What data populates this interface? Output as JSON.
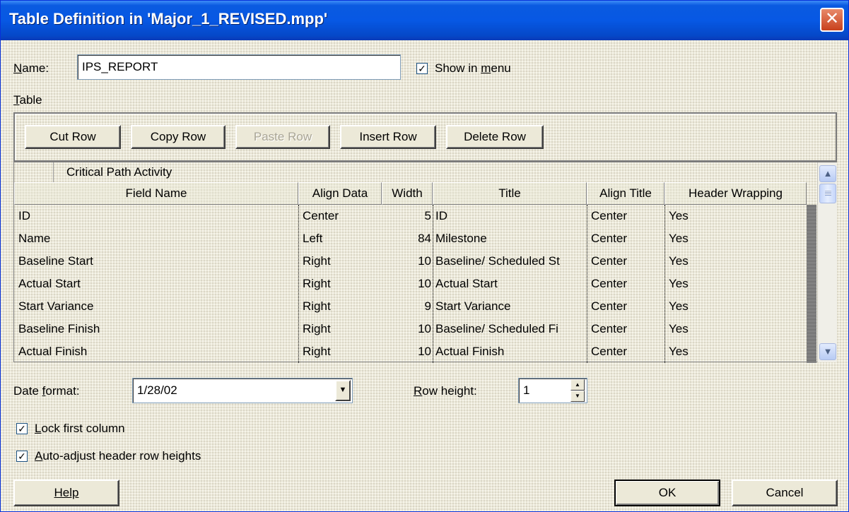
{
  "window": {
    "title": "Table Definition in 'Major_1_REVISED.mpp'"
  },
  "name_field": {
    "label": "Name:",
    "value": "IPS_REPORT"
  },
  "show_in_menu": {
    "label": "Show in menu",
    "checked": true
  },
  "table_group": {
    "label": "Table"
  },
  "toolbar": {
    "cut_row": "Cut Row",
    "copy_row": "Copy Row",
    "paste_row": "Paste Row",
    "insert_row": "Insert Row",
    "delete_row": "Delete Row"
  },
  "grid": {
    "edit_value": "Critical Path Activity",
    "columns": [
      "Field Name",
      "Align Data",
      "Width",
      "Title",
      "Align Title",
      "Header Wrapping"
    ],
    "rows": [
      [
        "ID",
        "Center",
        "5",
        "ID",
        "Center",
        "Yes"
      ],
      [
        "Name",
        "Left",
        "84",
        "Milestone",
        "Center",
        "Yes"
      ],
      [
        "Baseline Start",
        "Right",
        "10",
        "Baseline/ Scheduled St",
        "Center",
        "Yes"
      ],
      [
        "Actual Start",
        "Right",
        "10",
        "Actual Start",
        "Center",
        "Yes"
      ],
      [
        "Start Variance",
        "Right",
        "9",
        "Start Variance",
        "Center",
        "Yes"
      ],
      [
        "Baseline Finish",
        "Right",
        "10",
        "Baseline/ Scheduled Fi",
        "Center",
        "Yes"
      ],
      [
        "Actual Finish",
        "Right",
        "10",
        "Actual Finish",
        "Center",
        "Yes"
      ]
    ]
  },
  "date_format": {
    "label": "Date format:",
    "value": "1/28/02"
  },
  "row_height": {
    "label": "Row height:",
    "value": "1"
  },
  "lock_first_column": {
    "label": "Lock first column",
    "checked": true
  },
  "auto_adjust": {
    "label": "Auto-adjust header row heights",
    "checked": true
  },
  "footer": {
    "help": "Help",
    "ok": "OK",
    "cancel": "Cancel"
  },
  "icons": {
    "close": "close-icon",
    "scroll_up": "chevron-up-icon",
    "scroll_down": "chevron-down-icon",
    "dropdown": "dropdown-arrow-icon",
    "checkbox": "checkmark-icon"
  }
}
